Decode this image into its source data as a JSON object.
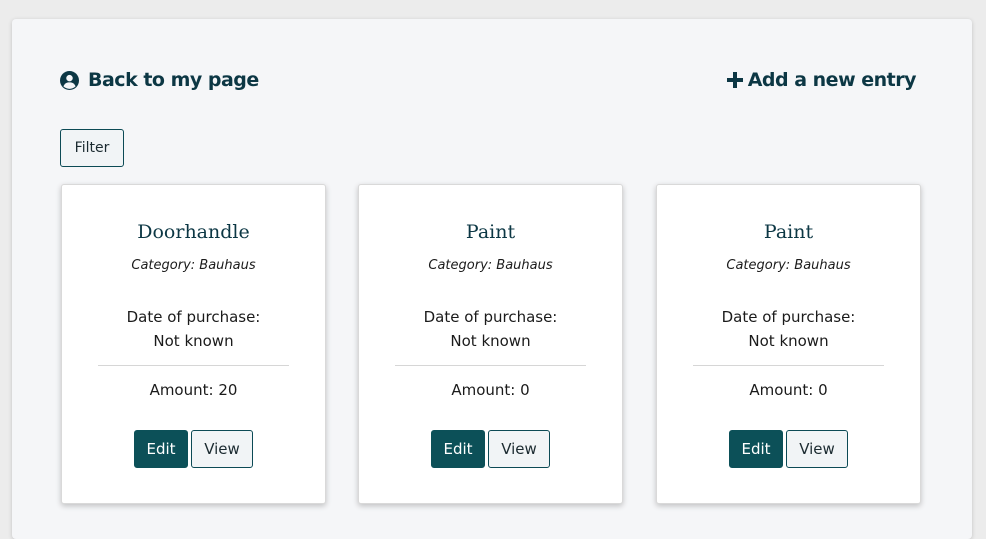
{
  "nav": {
    "back_label": "Back to my page",
    "add_label": "Add a new entry"
  },
  "filter": {
    "label": "Filter"
  },
  "cards": [
    {
      "title": "Doorhandle",
      "category": "Category: Bauhaus",
      "date_label": "Date of purchase:",
      "date_value": "Not known",
      "amount": "Amount: 20",
      "edit_label": "Edit",
      "view_label": "View"
    },
    {
      "title": "Paint",
      "category": "Category: Bauhaus",
      "date_label": "Date of purchase:",
      "date_value": "Not known",
      "amount": "Amount: 0",
      "edit_label": "Edit",
      "view_label": "View"
    },
    {
      "title": "Paint",
      "category": "Category: Bauhaus",
      "date_label": "Date of purchase:",
      "date_value": "Not known",
      "amount": "Amount: 0",
      "edit_label": "Edit",
      "view_label": "View"
    }
  ],
  "colors": {
    "accent": "#0c3744",
    "button_primary": "#0c5058",
    "panel_bg": "#f5f6f8",
    "page_bg": "#ececec"
  },
  "icons": {
    "back": "user-circle-icon",
    "add": "plus-icon"
  }
}
